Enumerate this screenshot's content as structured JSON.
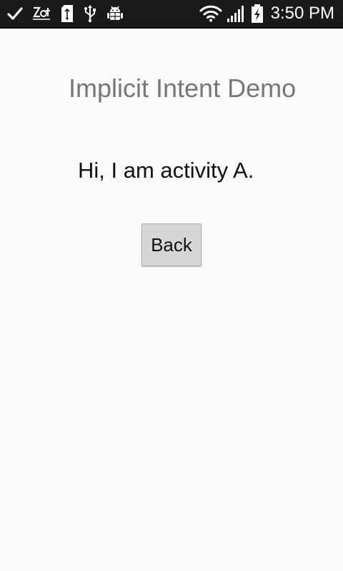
{
  "status_bar": {
    "time": "3:50 PM",
    "left_icons": [
      "check-icon",
      "app-notification-icon",
      "sd-card-icon",
      "usb-icon",
      "android-debug-icon"
    ],
    "right_icons": [
      "wifi-icon",
      "signal-icon",
      "battery-charging-icon"
    ]
  },
  "app": {
    "title": "Implicit Intent Demo"
  },
  "main": {
    "message": "Hi, I am activity A.",
    "back_label": "Back"
  },
  "colors": {
    "background": "#fafafa",
    "status_bar": "#1a1a1a",
    "title": "#777777",
    "button": "#d6d6d6"
  }
}
